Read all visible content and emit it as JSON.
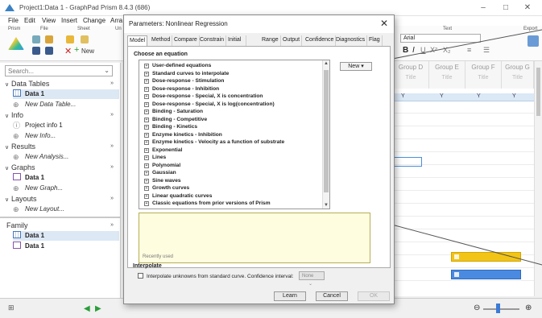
{
  "window": {
    "title": "Project1:Data 1 - GraphPad Prism 8.4.3 (686)"
  },
  "menu": [
    "File",
    "Edit",
    "View",
    "Insert",
    "Change",
    "Arra"
  ],
  "ribbon": {
    "groups": [
      "Prism",
      "File",
      "Sheet",
      "Un",
      "Text",
      "Export"
    ],
    "font_name": "Arial",
    "new_label": "New"
  },
  "navigator": {
    "search_placeholder": "Search...",
    "sections": [
      {
        "label": "Data Tables",
        "items": [
          {
            "label": "Data 1",
            "bold": true,
            "selected": true
          },
          {
            "label": "New Data Table...",
            "new": true
          }
        ]
      },
      {
        "label": "Info",
        "items": [
          {
            "label": "Project info 1"
          },
          {
            "label": "New Info...",
            "new": true
          }
        ]
      },
      {
        "label": "Results",
        "items": [
          {
            "label": "New Analysis...",
            "new": true
          }
        ]
      },
      {
        "label": "Graphs",
        "items": [
          {
            "label": "Data 1",
            "bold": true
          },
          {
            "label": "New Graph...",
            "new": true
          }
        ]
      },
      {
        "label": "Layouts",
        "items": [
          {
            "label": "New Layout...",
            "new": true
          }
        ]
      }
    ],
    "family": {
      "label": "Family",
      "items": [
        "Data 1",
        "Data 1"
      ]
    }
  },
  "sheet": {
    "columns": [
      "Group D",
      "Group E",
      "Group F",
      "Group G"
    ],
    "subtitle": "Title",
    "y_label": "Y"
  },
  "dialog": {
    "title": "Parameters: Nonlinear Regression",
    "tabs": [
      "Model",
      "Method",
      "Compare",
      "Constrain",
      "Initial values",
      "Range",
      "Output",
      "Confidence",
      "Diagnostics",
      "Flag"
    ],
    "choose_label": "Choose an equation",
    "equations": [
      "User-defined equations",
      "Standard curves to interpolate",
      "Dose-response - Stimulation",
      "Dose-response - Inhibition",
      "Dose-response - Special, X is concentration",
      "Dose-response - Special, X is log(concentration)",
      "Binding - Saturation",
      "Binding - Competitive",
      "Binding - Kinetics",
      "Enzyme kinetics - Inhibition",
      "Enzyme kinetics - Velocity as a function of substrate",
      "Exponential",
      "Lines",
      "Polynomial",
      "Gaussian",
      "Sine waves",
      "Growth curves",
      "Linear quadratic curves",
      "Classic equations from prior versions of Prism"
    ],
    "new_button": "New",
    "recently_used": "Recently used",
    "interpolate_label": "Interpolate",
    "interpolate_checkbox": "Interpolate unknowns from standard curve. Confidence interval:",
    "ci_value": "None",
    "buttons": {
      "learn": "Learn",
      "cancel": "Cancel",
      "ok": "OK"
    }
  }
}
